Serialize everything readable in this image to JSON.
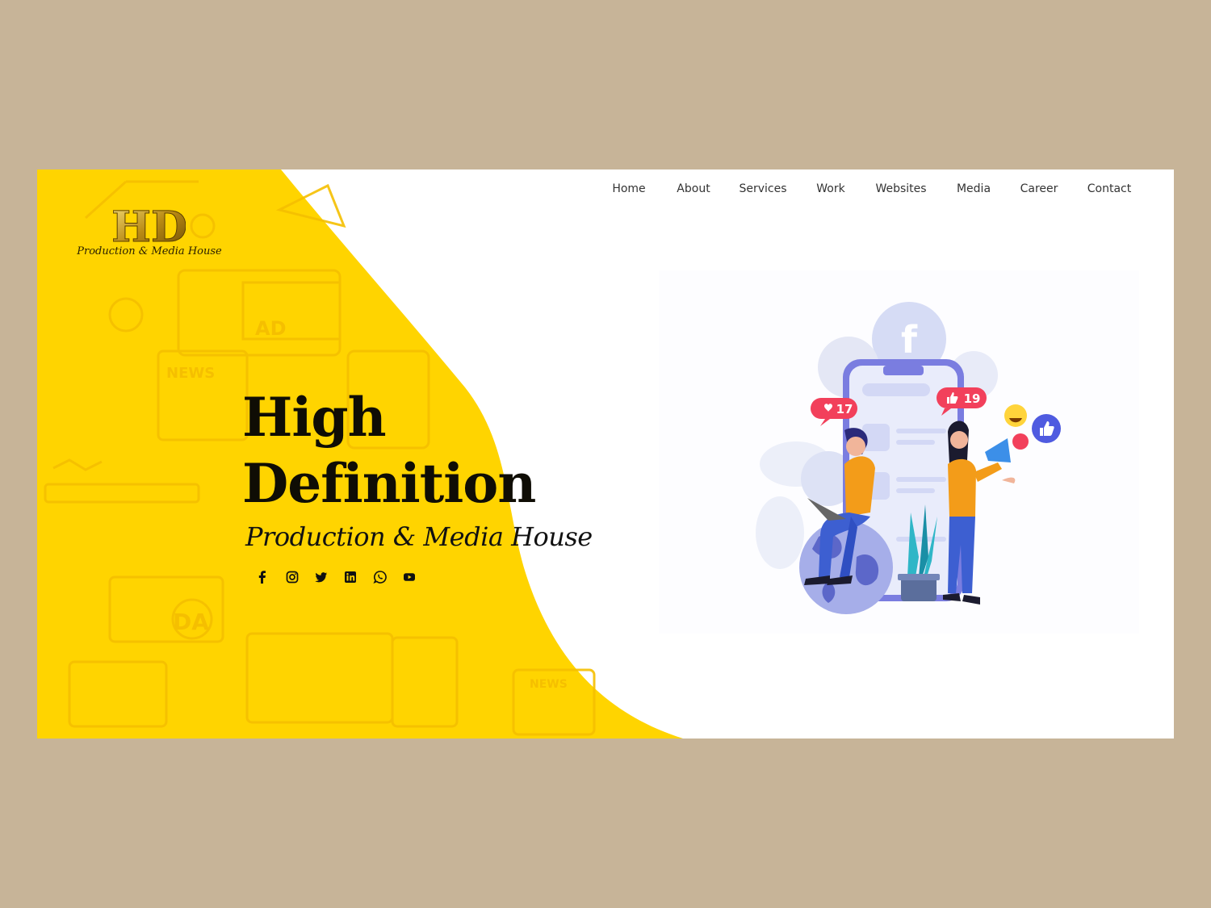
{
  "brand": {
    "logo_mark": "HD",
    "logo_subtitle": "Production & Media House"
  },
  "nav": {
    "items": [
      {
        "label": "Home"
      },
      {
        "label": "About"
      },
      {
        "label": "Services"
      },
      {
        "label": "Work"
      },
      {
        "label": "Websites"
      },
      {
        "label": "Media"
      },
      {
        "label": "Career"
      },
      {
        "label": "Contact"
      }
    ]
  },
  "hero": {
    "title_line1": "High",
    "title_line2": "Definition",
    "subtitle": "Production & Media House",
    "background_color": "#ffd400"
  },
  "social": [
    {
      "icon": "facebook-icon"
    },
    {
      "icon": "instagram-icon"
    },
    {
      "icon": "twitter-icon"
    },
    {
      "icon": "linkedin-icon"
    },
    {
      "icon": "whatsapp-icon"
    },
    {
      "icon": "youtube-icon"
    }
  ],
  "illustration": {
    "like_count_1": "17",
    "like_count_2": "19",
    "bg_pattern_labels": {
      "ad": "AD",
      "news": "NEWS",
      "da": "DA",
      "news_mirror": "NEWS"
    }
  }
}
